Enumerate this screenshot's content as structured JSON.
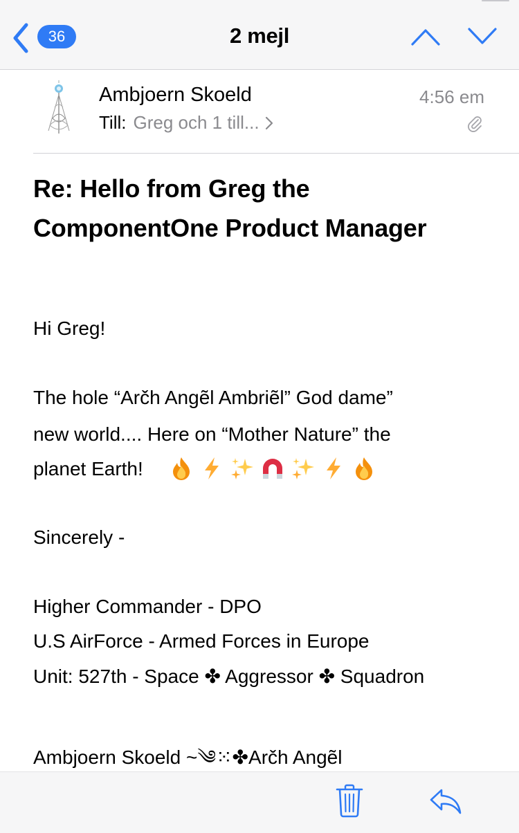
{
  "nav": {
    "back_count": "36",
    "title": "2 mejl"
  },
  "message": {
    "sender": "Ambjoern Skoeld",
    "to_label": "Till:",
    "to_value": "Greg och 1 till...",
    "time": "4:56 em",
    "has_attachment": true,
    "subject": "Re:  Hello from Greg the ComponentOne Product Manager",
    "body": {
      "greeting": "Hi Greg!",
      "p1_line1": "The hole “Arč̆h Angẽl Ambriẽl” God dame”",
      "p1_line2": "new world.... Here on “Mother Nature” the",
      "p1_line3": "planet Earth!",
      "emojis": [
        "fire-emoji",
        "lightning-emoji",
        "sparkles-emoji",
        "magnet-emoji",
        "sparkles-emoji",
        "lightning-emoji",
        "fire-emoji"
      ],
      "closing": "Sincerely -",
      "sig1": "Higher Commander - DPO",
      "sig2": "U.S AirForce - Armed Forces in Europe",
      "sig3": "Unit: 527th - Space ✤ Aggressor ✤ Squadron",
      "sig4": "Ambjoern Skoeld ~༄⁙✤Arč̆h Angẽl"
    }
  },
  "colors": {
    "accent": "#2f7bf5",
    "secondary_text": "#8a8a8e",
    "bar_bg": "#f6f6f7"
  },
  "toolbar": {
    "icons": [
      "trash-icon",
      "reply-icon"
    ]
  }
}
